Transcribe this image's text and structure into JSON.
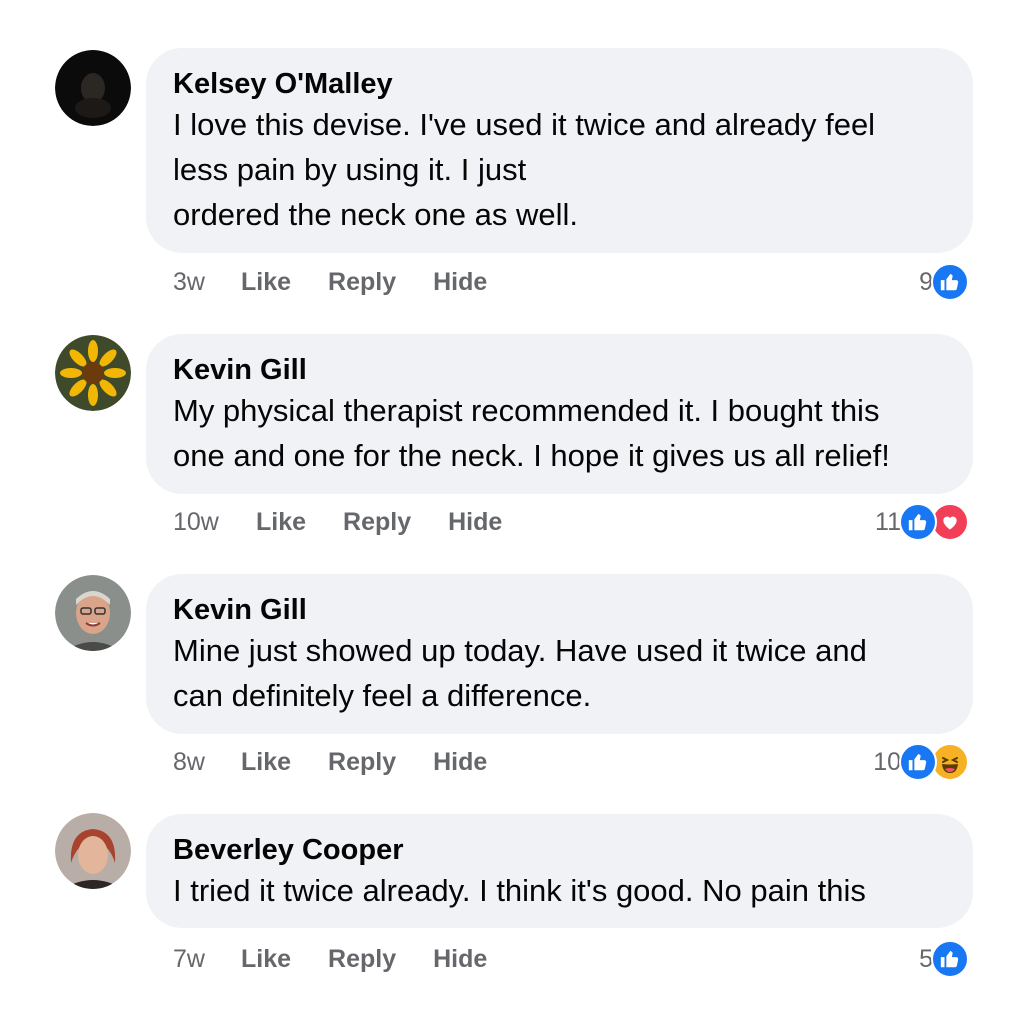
{
  "colors": {
    "bubble": "#f0f2f5",
    "like_blue": "#1877f2",
    "love_red": "#f33e58",
    "haha_yellow": "#f7b125",
    "meta_gray": "#65676b"
  },
  "comments": [
    {
      "author": "Kelsey O'Malley",
      "text": "I love this devise. I've used it twice and already feel\nless pain by using it. I just\nordered the neck one as well.",
      "time": "3w",
      "actions": {
        "like": "Like",
        "reply": "Reply",
        "hide": "Hide"
      },
      "reaction_count": "9",
      "reactions": [
        "like-icon"
      ]
    },
    {
      "author": "Kevin Gill",
      "text": "My physical therapist recommended it. I bought this\none and one for the neck. I hope it gives us all relief!",
      "time": "10w",
      "actions": {
        "like": "Like",
        "reply": "Reply",
        "hide": "Hide"
      },
      "reaction_count": "11",
      "reactions": [
        "like-icon",
        "love-icon"
      ]
    },
    {
      "author": "Kevin Gill",
      "text": "Mine just showed up today. Have used it twice and\ncan definitely feel a difference.",
      "time": "8w",
      "actions": {
        "like": "Like",
        "reply": "Reply",
        "hide": "Hide"
      },
      "reaction_count": "10",
      "reactions": [
        "like-icon",
        "haha-icon"
      ]
    },
    {
      "author": "Beverley Cooper",
      "text": "I tried it twice already. I think it's good. No pain this",
      "time": "7w",
      "actions": {
        "like": "Like",
        "reply": "Reply",
        "hide": "Hide"
      },
      "reaction_count": "5",
      "reactions": [
        "like-icon"
      ]
    }
  ]
}
